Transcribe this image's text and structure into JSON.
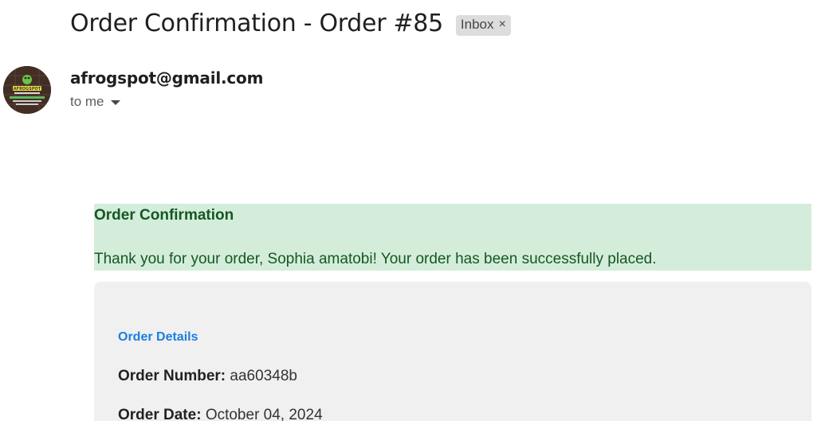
{
  "email": {
    "subject": "Order Confirmation - Order #85",
    "label_chip": "Inbox",
    "label_close": "×",
    "sender": "afrogspot@gmail.com",
    "recipient": "to me",
    "avatar_logo_text": "AFROGSPOT"
  },
  "body": {
    "banner_title": "Order Confirmation",
    "banner_message": "Thank you for your order, Sophia amatobi! Your order has been successfully placed.",
    "details_heading": "Order Details",
    "order_number_label": "Order Number:",
    "order_number_value": "aa60348b",
    "order_date_label": "Order Date:",
    "order_date_value": "October 04, 2024"
  },
  "colors": {
    "banner_bg": "#d4edda",
    "banner_text": "#155724",
    "details_bg": "#f0f0f0",
    "details_heading": "#1a7fe0"
  }
}
